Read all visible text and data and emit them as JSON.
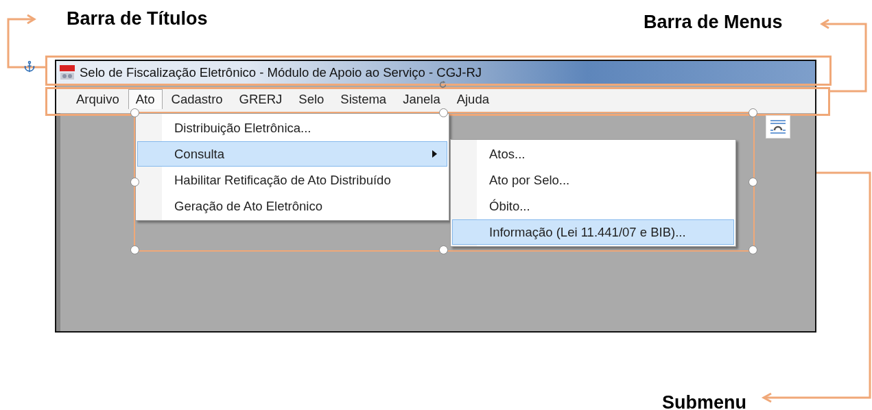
{
  "annotations": [
    {
      "kind": "title",
      "label": "Barra de Títulos"
    },
    {
      "kind": "menu",
      "label": "Barra de Menus"
    },
    {
      "kind": "submenu",
      "label": "Submenu"
    }
  ],
  "window": {
    "title": "Selo de Fiscalização Eletrônico - Módulo de Apoio ao Serviço - CGJ-RJ"
  },
  "menu_bar": [
    {
      "label": "Arquivo",
      "selected": false
    },
    {
      "label": "Ato",
      "selected": true
    },
    {
      "label": "Cadastro",
      "selected": false
    },
    {
      "label": "GRERJ",
      "selected": false
    },
    {
      "label": "Selo",
      "selected": false
    },
    {
      "label": "Sistema",
      "selected": false
    },
    {
      "label": "Janela",
      "selected": false
    },
    {
      "label": "Ajuda",
      "selected": false
    }
  ],
  "dropdown": [
    {
      "label": "Distribuição Eletrônica...",
      "selected": false,
      "has_submenu": false
    },
    {
      "label": "Consulta",
      "selected": true,
      "has_submenu": true
    },
    {
      "label": "Habilitar Retificação de Ato Distribuído",
      "selected": false,
      "has_submenu": false
    },
    {
      "label": "Geração de Ato Eletrônico",
      "selected": false,
      "has_submenu": false
    }
  ],
  "submenu": [
    {
      "label": "Atos...",
      "selected": false
    },
    {
      "label": "Ato por Selo...",
      "selected": false
    },
    {
      "label": "Óbito...",
      "selected": false
    },
    {
      "label": "Informação (Lei 11.441/07 e BIB)...",
      "selected": true
    }
  ]
}
